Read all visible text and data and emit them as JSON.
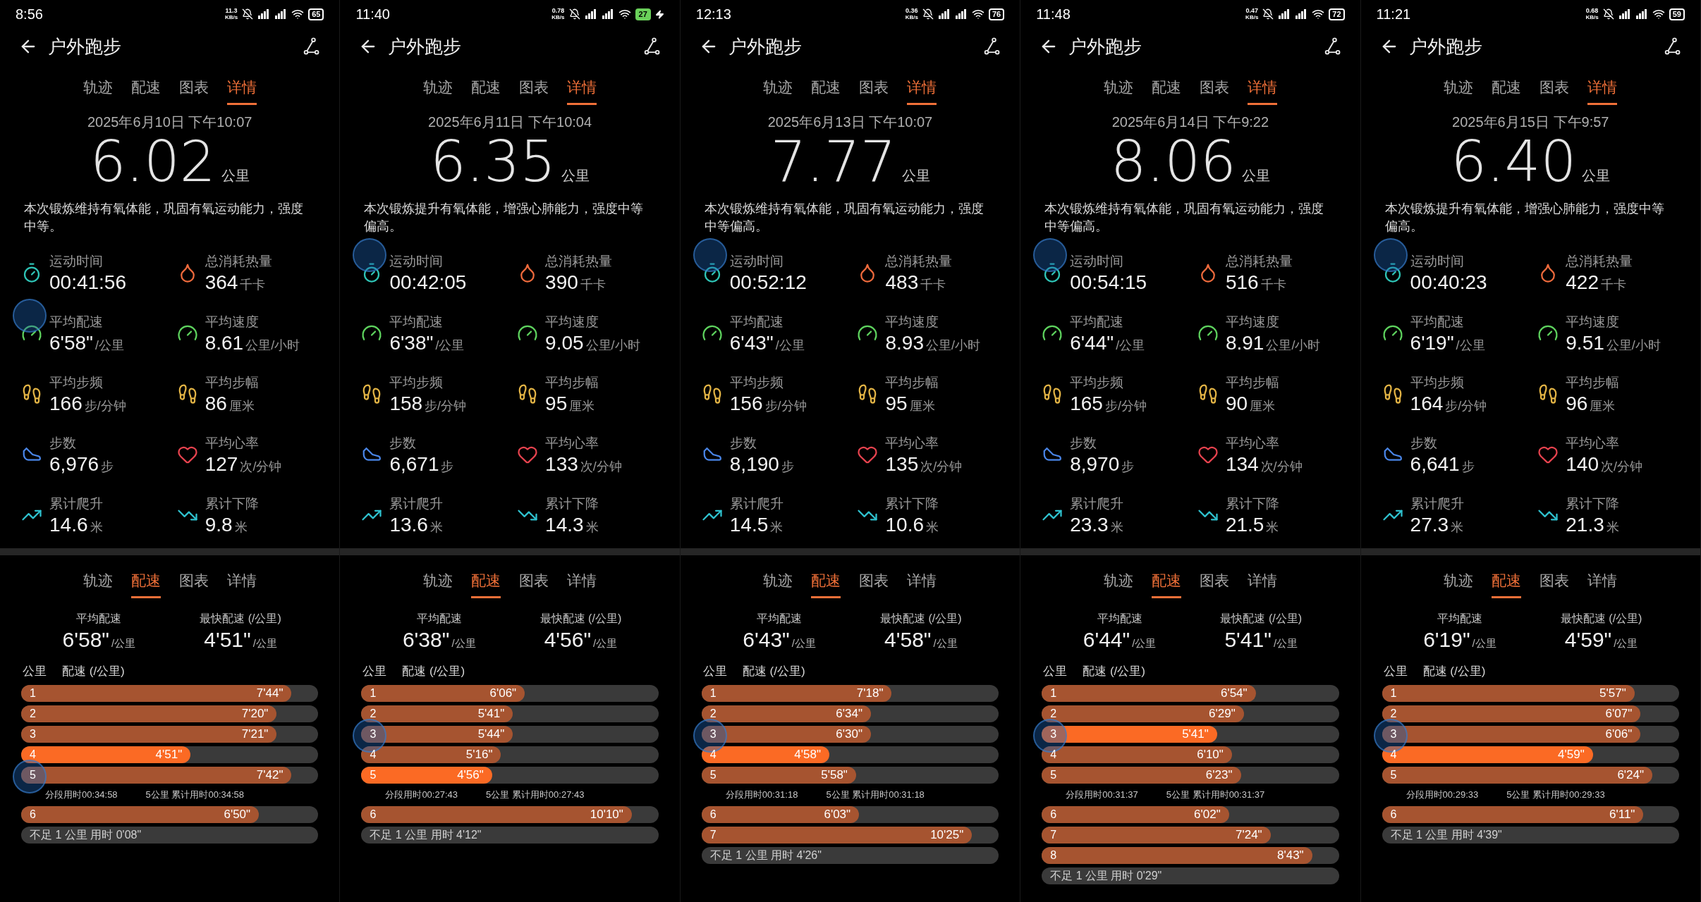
{
  "panels": [
    {
      "status": {
        "time": "8:56",
        "speed": "11.3",
        "speed_unit": "KB/s",
        "battery": "65",
        "charging": false
      },
      "title": "户外跑步",
      "tabs": [
        {
          "label": "轨迹",
          "selected": false
        },
        {
          "label": "配速",
          "selected": false
        },
        {
          "label": "图表",
          "selected": false
        },
        {
          "label": "详情",
          "selected": true
        }
      ],
      "date": "2025年6月10日 下午10:07",
      "distance": "6.02",
      "distance_unit": "公里",
      "summary": "本次锻炼维持有氧体能，巩固有氧运动能力，强度中等。",
      "metrics": [
        {
          "kind": "time",
          "label": "运动时间",
          "value": "00:41:56",
          "bubble": false
        },
        {
          "kind": "calories",
          "label": "总消耗热量",
          "value": "364",
          "unit": "千卡",
          "bubble": false
        },
        {
          "kind": "pace",
          "label": "平均配速",
          "value": "6'58\"",
          "unit": "/公里",
          "bubble": true
        },
        {
          "kind": "speed",
          "label": "平均速度",
          "value": "8.61",
          "unit": "公里/小时",
          "bubble": false
        },
        {
          "kind": "cadence",
          "label": "平均步频",
          "value": "166",
          "unit": "步/分钟",
          "bubble": false
        },
        {
          "kind": "stride",
          "label": "平均步幅",
          "value": "86",
          "unit": "厘米",
          "bubble": false
        },
        {
          "kind": "steps",
          "label": "步数",
          "value": "6,976",
          "unit": "步",
          "bubble": false
        },
        {
          "kind": "heart_rate",
          "label": "平均心率",
          "value": "127",
          "unit": "次/分钟",
          "bubble": false
        },
        {
          "kind": "ascent",
          "label": "累计爬升",
          "value": "14.6",
          "unit": "米",
          "bubble": false
        },
        {
          "kind": "descent",
          "label": "累计下降",
          "value": "9.8",
          "unit": "米",
          "bubble": false
        }
      ],
      "pace": {
        "tabs": [
          {
            "label": "轨迹",
            "selected": false
          },
          {
            "label": "配速",
            "selected": true
          },
          {
            "label": "图表",
            "selected": false
          },
          {
            "label": "详情",
            "selected": false
          }
        ],
        "average": {
          "label": "平均配速",
          "value": "6'58\"",
          "unit": "/公里"
        },
        "fastest": {
          "label": "最快配速 (/公里)",
          "value": "4'51\"",
          "unit": "/公里"
        },
        "header": [
          "公里",
          "配速 (/公里)"
        ],
        "rows": [
          {
            "kind": "split",
            "km": "1",
            "pace": "7'44\"",
            "level": 0.91,
            "fastest": false,
            "bubble": false
          },
          {
            "kind": "split",
            "km": "2",
            "pace": "7'20\"",
            "level": 0.86,
            "fastest": false,
            "bubble": false
          },
          {
            "kind": "split",
            "km": "3",
            "pace": "7'21\"",
            "level": 0.86,
            "fastest": false,
            "bubble": false
          },
          {
            "kind": "split",
            "km": "4",
            "pace": "4'51\"",
            "level": 0.57,
            "fastest": true,
            "bubble": false
          },
          {
            "kind": "split",
            "km": "5",
            "pace": "7'42\"",
            "level": 0.91,
            "fastest": false,
            "bubble": true
          },
          {
            "kind": "subtotal",
            "segment": "分段用时00:34:58",
            "cumulative": "5公里 累计用时00:34:58"
          },
          {
            "kind": "split",
            "km": "6",
            "pace": "6'50\"",
            "level": 0.8,
            "fastest": false,
            "bubble": false
          },
          {
            "kind": "remainder",
            "text": "不足 1 公里 用时 0'08\""
          }
        ]
      }
    },
    {
      "status": {
        "time": "11:40",
        "speed": "0.78",
        "speed_unit": "KB/s",
        "battery": "27",
        "charging": true
      },
      "title": "户外跑步",
      "tabs": [
        {
          "label": "轨迹",
          "selected": false
        },
        {
          "label": "配速",
          "selected": false
        },
        {
          "label": "图表",
          "selected": false
        },
        {
          "label": "详情",
          "selected": true
        }
      ],
      "date": "2025年6月11日 下午10:04",
      "distance": "6.35",
      "distance_unit": "公里",
      "summary": "本次锻炼提升有氧体能，增强心肺能力，强度中等偏高。",
      "metrics": [
        {
          "kind": "time",
          "label": "运动时间",
          "value": "00:42:05",
          "bubble": true
        },
        {
          "kind": "calories",
          "label": "总消耗热量",
          "value": "390",
          "unit": "千卡",
          "bubble": false
        },
        {
          "kind": "pace",
          "label": "平均配速",
          "value": "6'38\"",
          "unit": "/公里",
          "bubble": false
        },
        {
          "kind": "speed",
          "label": "平均速度",
          "value": "9.05",
          "unit": "公里/小时",
          "bubble": false
        },
        {
          "kind": "cadence",
          "label": "平均步频",
          "value": "158",
          "unit": "步/分钟",
          "bubble": false
        },
        {
          "kind": "stride",
          "label": "平均步幅",
          "value": "95",
          "unit": "厘米",
          "bubble": false
        },
        {
          "kind": "steps",
          "label": "步数",
          "value": "6,671",
          "unit": "步",
          "bubble": false
        },
        {
          "kind": "heart_rate",
          "label": "平均心率",
          "value": "133",
          "unit": "次/分钟",
          "bubble": false
        },
        {
          "kind": "ascent",
          "label": "累计爬升",
          "value": "13.6",
          "unit": "米",
          "bubble": false
        },
        {
          "kind": "descent",
          "label": "累计下降",
          "value": "14.3",
          "unit": "米",
          "bubble": false
        }
      ],
      "pace": {
        "tabs": [
          {
            "label": "轨迹",
            "selected": false
          },
          {
            "label": "配速",
            "selected": true
          },
          {
            "label": "图表",
            "selected": false
          },
          {
            "label": "详情",
            "selected": false
          }
        ],
        "average": {
          "label": "平均配速",
          "value": "6'38\"",
          "unit": "/公里"
        },
        "fastest": {
          "label": "最快配速 (/公里)",
          "value": "4'56\"",
          "unit": "/公里"
        },
        "header": [
          "公里",
          "配速 (/公里)"
        ],
        "rows": [
          {
            "kind": "split",
            "km": "1",
            "pace": "6'06\"",
            "level": 0.55,
            "fastest": false,
            "bubble": false
          },
          {
            "kind": "split",
            "km": "2",
            "pace": "5'41\"",
            "level": 0.51,
            "fastest": false,
            "bubble": false
          },
          {
            "kind": "split",
            "km": "3",
            "pace": "5'44\"",
            "level": 0.51,
            "fastest": false,
            "bubble": true
          },
          {
            "kind": "split",
            "km": "4",
            "pace": "5'16\"",
            "level": 0.47,
            "fastest": false,
            "bubble": false
          },
          {
            "kind": "split",
            "km": "5",
            "pace": "4'56\"",
            "level": 0.44,
            "fastest": true,
            "bubble": false
          },
          {
            "kind": "subtotal",
            "segment": "分段用时00:27:43",
            "cumulative": "5公里 累计用时00:27:43"
          },
          {
            "kind": "split",
            "km": "6",
            "pace": "10'10\"",
            "level": 0.91,
            "fastest": false,
            "bubble": false
          },
          {
            "kind": "remainder",
            "text": "不足 1 公里 用时 4'12\""
          }
        ]
      }
    },
    {
      "status": {
        "time": "12:13",
        "speed": "0.36",
        "speed_unit": "KB/s",
        "battery": "76",
        "charging": false
      },
      "title": "户外跑步",
      "tabs": [
        {
          "label": "轨迹",
          "selected": false
        },
        {
          "label": "配速",
          "selected": false
        },
        {
          "label": "图表",
          "selected": false
        },
        {
          "label": "详情",
          "selected": true
        }
      ],
      "date": "2025年6月13日 下午10:07",
      "distance": "7.77",
      "distance_unit": "公里",
      "summary": "本次锻炼维持有氧体能，巩固有氧运动能力，强度中等偏高。",
      "metrics": [
        {
          "kind": "time",
          "label": "运动时间",
          "value": "00:52:12",
          "bubble": true
        },
        {
          "kind": "calories",
          "label": "总消耗热量",
          "value": "483",
          "unit": "千卡",
          "bubble": false
        },
        {
          "kind": "pace",
          "label": "平均配速",
          "value": "6'43\"",
          "unit": "/公里",
          "bubble": false
        },
        {
          "kind": "speed",
          "label": "平均速度",
          "value": "8.93",
          "unit": "公里/小时",
          "bubble": false
        },
        {
          "kind": "cadence",
          "label": "平均步频",
          "value": "156",
          "unit": "步/分钟",
          "bubble": false
        },
        {
          "kind": "stride",
          "label": "平均步幅",
          "value": "95",
          "unit": "厘米",
          "bubble": false
        },
        {
          "kind": "steps",
          "label": "步数",
          "value": "8,190",
          "unit": "步",
          "bubble": false
        },
        {
          "kind": "heart_rate",
          "label": "平均心率",
          "value": "135",
          "unit": "次/分钟",
          "bubble": false
        },
        {
          "kind": "ascent",
          "label": "累计爬升",
          "value": "14.5",
          "unit": "米",
          "bubble": false
        },
        {
          "kind": "descent",
          "label": "累计下降",
          "value": "10.6",
          "unit": "米",
          "bubble": false
        }
      ],
      "pace": {
        "tabs": [
          {
            "label": "轨迹",
            "selected": false
          },
          {
            "label": "配速",
            "selected": true
          },
          {
            "label": "图表",
            "selected": false
          },
          {
            "label": "详情",
            "selected": false
          }
        ],
        "average": {
          "label": "平均配速",
          "value": "6'43\"",
          "unit": "/公里"
        },
        "fastest": {
          "label": "最快配速 (/公里)",
          "value": "4'58\"",
          "unit": "/公里"
        },
        "header": [
          "公里",
          "配速 (/公里)"
        ],
        "rows": [
          {
            "kind": "split",
            "km": "1",
            "pace": "7'18\"",
            "level": 0.64,
            "fastest": false,
            "bubble": false
          },
          {
            "kind": "split",
            "km": "2",
            "pace": "6'34\"",
            "level": 0.57,
            "fastest": false,
            "bubble": false
          },
          {
            "kind": "split",
            "km": "3",
            "pace": "6'30\"",
            "level": 0.57,
            "fastest": false,
            "bubble": true
          },
          {
            "kind": "split",
            "km": "4",
            "pace": "4'58\"",
            "level": 0.43,
            "fastest": true,
            "bubble": false
          },
          {
            "kind": "split",
            "km": "5",
            "pace": "5'58\"",
            "level": 0.52,
            "fastest": false,
            "bubble": false
          },
          {
            "kind": "subtotal",
            "segment": "分段用时00:31:18",
            "cumulative": "5公里 累计用时00:31:18"
          },
          {
            "kind": "split",
            "km": "6",
            "pace": "6'03\"",
            "level": 0.53,
            "fastest": false,
            "bubble": false
          },
          {
            "kind": "split",
            "km": "7",
            "pace": "10'25\"",
            "level": 0.91,
            "fastest": false,
            "bubble": false
          },
          {
            "kind": "remainder",
            "text": "不足 1 公里 用时 4'26\""
          }
        ]
      }
    },
    {
      "status": {
        "time": "11:48",
        "speed": "0.47",
        "speed_unit": "KB/s",
        "battery": "72",
        "charging": false
      },
      "title": "户外跑步",
      "tabs": [
        {
          "label": "轨迹",
          "selected": false
        },
        {
          "label": "配速",
          "selected": false
        },
        {
          "label": "图表",
          "selected": false
        },
        {
          "label": "详情",
          "selected": true
        }
      ],
      "date": "2025年6月14日 下午9:22",
      "distance": "8.06",
      "distance_unit": "公里",
      "summary": "本次锻炼维持有氧体能，巩固有氧运动能力，强度中等偏高。",
      "metrics": [
        {
          "kind": "time",
          "label": "运动时间",
          "value": "00:54:15",
          "bubble": true
        },
        {
          "kind": "calories",
          "label": "总消耗热量",
          "value": "516",
          "unit": "千卡",
          "bubble": false
        },
        {
          "kind": "pace",
          "label": "平均配速",
          "value": "6'44\"",
          "unit": "/公里",
          "bubble": false
        },
        {
          "kind": "speed",
          "label": "平均速度",
          "value": "8.91",
          "unit": "公里/小时",
          "bubble": false
        },
        {
          "kind": "cadence",
          "label": "平均步频",
          "value": "165",
          "unit": "步/分钟",
          "bubble": false
        },
        {
          "kind": "stride",
          "label": "平均步幅",
          "value": "90",
          "unit": "厘米",
          "bubble": false
        },
        {
          "kind": "steps",
          "label": "步数",
          "value": "8,970",
          "unit": "步",
          "bubble": false
        },
        {
          "kind": "heart_rate",
          "label": "平均心率",
          "value": "134",
          "unit": "次/分钟",
          "bubble": false
        },
        {
          "kind": "ascent",
          "label": "累计爬升",
          "value": "23.3",
          "unit": "米",
          "bubble": false
        },
        {
          "kind": "descent",
          "label": "累计下降",
          "value": "21.5",
          "unit": "米",
          "bubble": false
        }
      ],
      "pace": {
        "tabs": [
          {
            "label": "轨迹",
            "selected": false
          },
          {
            "label": "配速",
            "selected": true
          },
          {
            "label": "图表",
            "selected": false
          },
          {
            "label": "详情",
            "selected": false
          }
        ],
        "average": {
          "label": "平均配速",
          "value": "6'44\"",
          "unit": "/公里"
        },
        "fastest": {
          "label": "最快配速 (/公里)",
          "value": "5'41\"",
          "unit": "/公里"
        },
        "header": [
          "公里",
          "配速 (/公里)"
        ],
        "rows": [
          {
            "kind": "split",
            "km": "1",
            "pace": "6'54\"",
            "level": 0.72,
            "fastest": false,
            "bubble": false
          },
          {
            "kind": "split",
            "km": "2",
            "pace": "6'29\"",
            "level": 0.68,
            "fastest": false,
            "bubble": false
          },
          {
            "kind": "split",
            "km": "3",
            "pace": "5'41\"",
            "level": 0.59,
            "fastest": true,
            "bubble": true
          },
          {
            "kind": "split",
            "km": "4",
            "pace": "6'10\"",
            "level": 0.64,
            "fastest": false,
            "bubble": false
          },
          {
            "kind": "split",
            "km": "5",
            "pace": "6'23\"",
            "level": 0.67,
            "fastest": false,
            "bubble": false
          },
          {
            "kind": "subtotal",
            "segment": "分段用时00:31:37",
            "cumulative": "5公里 累计用时00:31:37"
          },
          {
            "kind": "split",
            "km": "6",
            "pace": "6'02\"",
            "level": 0.63,
            "fastest": false,
            "bubble": false
          },
          {
            "kind": "split",
            "km": "7",
            "pace": "7'24\"",
            "level": 0.77,
            "fastest": false,
            "bubble": false
          },
          {
            "kind": "split",
            "km": "8",
            "pace": "8'43\"",
            "level": 0.91,
            "fastest": false,
            "bubble": false
          },
          {
            "kind": "remainder",
            "text": "不足 1 公里 用时 0'29\""
          }
        ]
      }
    },
    {
      "status": {
        "time": "11:21",
        "speed": "0.68",
        "speed_unit": "KB/s",
        "battery": "59",
        "charging": false
      },
      "title": "户外跑步",
      "tabs": [
        {
          "label": "轨迹",
          "selected": false
        },
        {
          "label": "配速",
          "selected": false
        },
        {
          "label": "图表",
          "selected": false
        },
        {
          "label": "详情",
          "selected": true
        }
      ],
      "date": "2025年6月15日 下午9:57",
      "distance": "6.40",
      "distance_unit": "公里",
      "summary": "本次锻炼提升有氧体能，增强心肺能力，强度中等偏高。",
      "metrics": [
        {
          "kind": "time",
          "label": "运动时间",
          "value": "00:40:23",
          "bubble": true
        },
        {
          "kind": "calories",
          "label": "总消耗热量",
          "value": "422",
          "unit": "千卡",
          "bubble": false
        },
        {
          "kind": "pace",
          "label": "平均配速",
          "value": "6'19\"",
          "unit": "/公里",
          "bubble": false
        },
        {
          "kind": "speed",
          "label": "平均速度",
          "value": "9.51",
          "unit": "公里/小时",
          "bubble": false
        },
        {
          "kind": "cadence",
          "label": "平均步频",
          "value": "164",
          "unit": "步/分钟",
          "bubble": false
        },
        {
          "kind": "stride",
          "label": "平均步幅",
          "value": "96",
          "unit": "厘米",
          "bubble": false
        },
        {
          "kind": "steps",
          "label": "步数",
          "value": "6,641",
          "unit": "步",
          "bubble": false
        },
        {
          "kind": "heart_rate",
          "label": "平均心率",
          "value": "140",
          "unit": "次/分钟",
          "bubble": false
        },
        {
          "kind": "ascent",
          "label": "累计爬升",
          "value": "27.3",
          "unit": "米",
          "bubble": false
        },
        {
          "kind": "descent",
          "label": "累计下降",
          "value": "21.3",
          "unit": "米",
          "bubble": false
        }
      ],
      "pace": {
        "tabs": [
          {
            "label": "轨迹",
            "selected": false
          },
          {
            "label": "配速",
            "selected": true
          },
          {
            "label": "图表",
            "selected": false
          },
          {
            "label": "详情",
            "selected": false
          }
        ],
        "average": {
          "label": "平均配速",
          "value": "6'19\"",
          "unit": "/公里"
        },
        "fastest": {
          "label": "最快配速 (/公里)",
          "value": "4'59\"",
          "unit": "/公里"
        },
        "header": [
          "公里",
          "配速 (/公里)"
        ],
        "rows": [
          {
            "kind": "split",
            "km": "1",
            "pace": "5'57\"",
            "level": 0.85,
            "fastest": false,
            "bubble": false
          },
          {
            "kind": "split",
            "km": "2",
            "pace": "6'07\"",
            "level": 0.87,
            "fastest": false,
            "bubble": false
          },
          {
            "kind": "split",
            "km": "3",
            "pace": "6'06\"",
            "level": 0.87,
            "fastest": false,
            "bubble": true
          },
          {
            "kind": "split",
            "km": "4",
            "pace": "4'59\"",
            "level": 0.71,
            "fastest": true,
            "bubble": false
          },
          {
            "kind": "split",
            "km": "5",
            "pace": "6'24\"",
            "level": 0.91,
            "fastest": false,
            "bubble": false
          },
          {
            "kind": "subtotal",
            "segment": "分段用时00:29:33",
            "cumulative": "5公里 累计用时00:29:33"
          },
          {
            "kind": "split",
            "km": "6",
            "pace": "6'11\"",
            "level": 0.88,
            "fastest": false,
            "bubble": false
          },
          {
            "kind": "remainder",
            "text": "不足 1 公里 用时 4'39\""
          }
        ]
      }
    }
  ]
}
